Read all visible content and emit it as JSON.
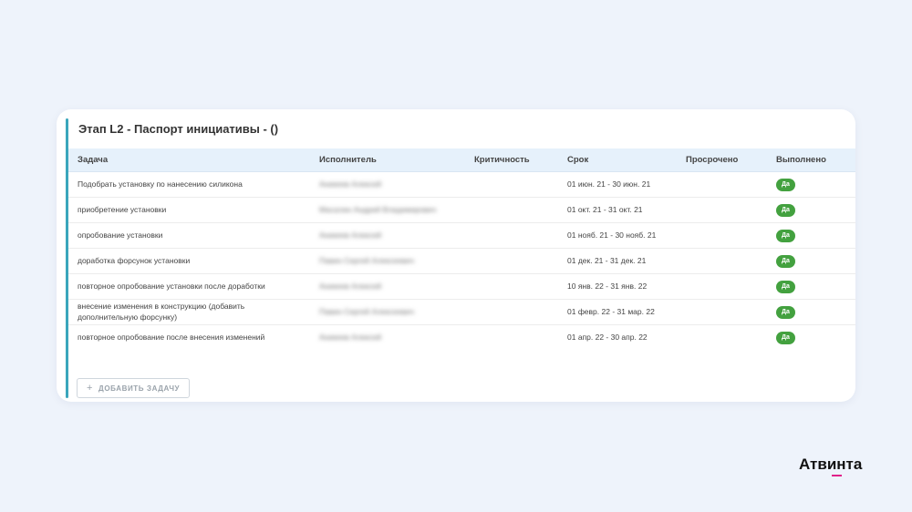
{
  "card": {
    "title": "Этап L2 - Паспорт инициативы - ()"
  },
  "table": {
    "columns": [
      "Задача",
      "Исполнитель",
      "Критичность",
      "Срок",
      "Просрочено",
      "Выполнено"
    ],
    "rows": [
      {
        "task": "Подобрать установку по нанесению силикона",
        "assignee": "Аникеев Алексей",
        "criticality": "",
        "deadline": "01 июн. 21 - 30 июн. 21",
        "overdue": "",
        "done": "Да"
      },
      {
        "task": "приобретение установки",
        "assignee": "Масалин Андрей Владимирович",
        "criticality": "",
        "deadline": "01 окт. 21 - 31 окт. 21",
        "overdue": "",
        "done": "Да"
      },
      {
        "task": "опробование установки",
        "assignee": "Аникеев Алексей",
        "criticality": "",
        "deadline": "01 нояб. 21 - 30 нояб. 21",
        "overdue": "",
        "done": "Да"
      },
      {
        "task": "доработка форсунок установки",
        "assignee": "Павин Сергей Алексеевич",
        "criticality": "",
        "deadline": "01 дек. 21 - 31 дек. 21",
        "overdue": "",
        "done": "Да"
      },
      {
        "task": "повторное опробование установки после доработки",
        "assignee": "Аникеев Алексей",
        "criticality": "",
        "deadline": "10 янв. 22 - 31 янв. 22",
        "overdue": "",
        "done": "Да"
      },
      {
        "task": "внесение изменения в конструкцию (добавить дополнительную форсунку)",
        "assignee": "Павин Сергей Алексеевич",
        "criticality": "",
        "deadline": "01 февр. 22 - 31 мар. 22",
        "overdue": "",
        "done": "Да"
      },
      {
        "task": "повторное опробование после внесения изменений",
        "assignee": "Аникеев Алексей",
        "criticality": "",
        "deadline": "01 апр. 22 - 30 апр. 22",
        "overdue": "",
        "done": "Да"
      }
    ]
  },
  "actions": {
    "add_task_plus": "+",
    "add_task_label": "ДОБАВИТЬ ЗАДАЧУ"
  },
  "brand": {
    "logo_text": "Атвинта"
  }
}
